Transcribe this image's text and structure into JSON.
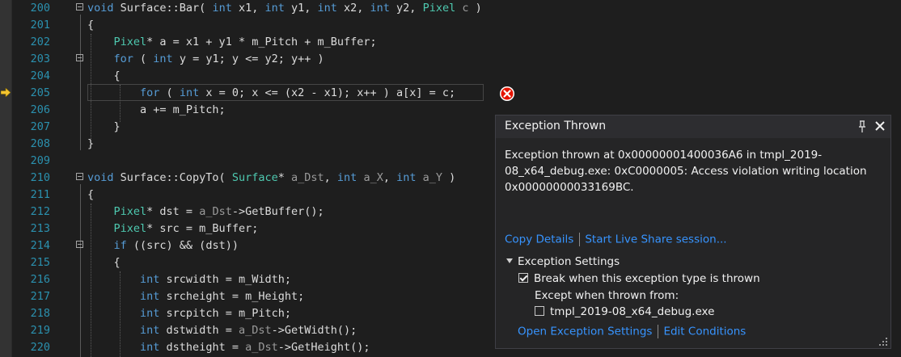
{
  "editor": {
    "lines": [
      {
        "num": "200",
        "tokens": [
          {
            "t": "void",
            "c": "kw"
          },
          {
            "t": " Surface::Bar( ",
            "c": ""
          },
          {
            "t": "int",
            "c": "kw"
          },
          {
            "t": " x1, ",
            "c": ""
          },
          {
            "t": "int",
            "c": "kw"
          },
          {
            "t": " y1, ",
            "c": ""
          },
          {
            "t": "int",
            "c": "kw"
          },
          {
            "t": " x2, ",
            "c": ""
          },
          {
            "t": "int",
            "c": "kw"
          },
          {
            "t": " y2, ",
            "c": ""
          },
          {
            "t": "Pixel",
            "c": "ty"
          },
          {
            "t": " ",
            "c": ""
          },
          {
            "t": "c",
            "c": "pm"
          },
          {
            "t": " )",
            "c": ""
          }
        ]
      },
      {
        "num": "201",
        "tokens": [
          {
            "t": "{",
            "c": ""
          }
        ]
      },
      {
        "num": "202",
        "tokens": [
          {
            "t": "    ",
            "c": ""
          },
          {
            "t": "Pixel",
            "c": "ty"
          },
          {
            "t": "* a = x1 + y1 * m_Pitch + m_Buffer;",
            "c": ""
          }
        ]
      },
      {
        "num": "203",
        "tokens": [
          {
            "t": "    ",
            "c": ""
          },
          {
            "t": "for",
            "c": "kw"
          },
          {
            "t": " ( ",
            "c": ""
          },
          {
            "t": "int",
            "c": "kw"
          },
          {
            "t": " y = y1; y <= y2; y++ )",
            "c": ""
          }
        ]
      },
      {
        "num": "204",
        "tokens": [
          {
            "t": "    {",
            "c": ""
          }
        ]
      },
      {
        "num": "205",
        "tokens": [
          {
            "t": "        ",
            "c": ""
          },
          {
            "t": "for",
            "c": "kw"
          },
          {
            "t": " ( ",
            "c": ""
          },
          {
            "t": "int",
            "c": "kw"
          },
          {
            "t": " x = 0; x <= (x2 - x1); x++ ) a[x] = c;",
            "c": ""
          }
        ]
      },
      {
        "num": "206",
        "tokens": [
          {
            "t": "        a += m_Pitch;",
            "c": ""
          }
        ]
      },
      {
        "num": "207",
        "tokens": [
          {
            "t": "    }",
            "c": ""
          }
        ]
      },
      {
        "num": "208",
        "tokens": [
          {
            "t": "}",
            "c": ""
          }
        ]
      },
      {
        "num": "209",
        "tokens": []
      },
      {
        "num": "210",
        "tokens": [
          {
            "t": "void",
            "c": "kw"
          },
          {
            "t": " Surface::CopyTo( ",
            "c": ""
          },
          {
            "t": "Surface",
            "c": "ty"
          },
          {
            "t": "* ",
            "c": ""
          },
          {
            "t": "a_Dst",
            "c": "pm"
          },
          {
            "t": ", ",
            "c": ""
          },
          {
            "t": "int",
            "c": "kw"
          },
          {
            "t": " ",
            "c": ""
          },
          {
            "t": "a_X",
            "c": "pm"
          },
          {
            "t": ", ",
            "c": ""
          },
          {
            "t": "int",
            "c": "kw"
          },
          {
            "t": " ",
            "c": ""
          },
          {
            "t": "a_Y",
            "c": "pm"
          },
          {
            "t": " )",
            "c": ""
          }
        ]
      },
      {
        "num": "211",
        "tokens": [
          {
            "t": "{",
            "c": ""
          }
        ]
      },
      {
        "num": "212",
        "tokens": [
          {
            "t": "    ",
            "c": ""
          },
          {
            "t": "Pixel",
            "c": "ty"
          },
          {
            "t": "* dst = ",
            "c": ""
          },
          {
            "t": "a_Dst",
            "c": "pm"
          },
          {
            "t": "->GetBuffer();",
            "c": ""
          }
        ]
      },
      {
        "num": "213",
        "tokens": [
          {
            "t": "    ",
            "c": ""
          },
          {
            "t": "Pixel",
            "c": "ty"
          },
          {
            "t": "* src = m_Buffer;",
            "c": ""
          }
        ]
      },
      {
        "num": "214",
        "tokens": [
          {
            "t": "    ",
            "c": ""
          },
          {
            "t": "if",
            "c": "kw"
          },
          {
            "t": " ((src) && (dst))",
            "c": ""
          }
        ]
      },
      {
        "num": "215",
        "tokens": [
          {
            "t": "    {",
            "c": ""
          }
        ]
      },
      {
        "num": "216",
        "tokens": [
          {
            "t": "        ",
            "c": ""
          },
          {
            "t": "int",
            "c": "kw"
          },
          {
            "t": " srcwidth = m_Width;",
            "c": ""
          }
        ]
      },
      {
        "num": "217",
        "tokens": [
          {
            "t": "        ",
            "c": ""
          },
          {
            "t": "int",
            "c": "kw"
          },
          {
            "t": " srcheight = m_Height;",
            "c": ""
          }
        ]
      },
      {
        "num": "218",
        "tokens": [
          {
            "t": "        ",
            "c": ""
          },
          {
            "t": "int",
            "c": "kw"
          },
          {
            "t": " srcpitch = m_Pitch;",
            "c": ""
          }
        ]
      },
      {
        "num": "219",
        "tokens": [
          {
            "t": "        ",
            "c": ""
          },
          {
            "t": "int",
            "c": "kw"
          },
          {
            "t": " dstwidth = ",
            "c": ""
          },
          {
            "t": "a_Dst",
            "c": "pm"
          },
          {
            "t": "->GetWidth();",
            "c": ""
          }
        ]
      },
      {
        "num": "220",
        "tokens": [
          {
            "t": "        ",
            "c": ""
          },
          {
            "t": "int",
            "c": "kw"
          },
          {
            "t": " dstheight = ",
            "c": ""
          },
          {
            "t": "a_Dst",
            "c": "pm"
          },
          {
            "t": "->GetHeight();",
            "c": ""
          }
        ]
      }
    ],
    "fold_lines": [
      "200",
      "203",
      "210",
      "214"
    ],
    "current_line": "205",
    "icons": {
      "exec": "current-statement-arrow-icon",
      "error": "exception-error-icon"
    },
    "colors": {
      "keyword": "#569cd6",
      "type": "#4ec9b0",
      "param": "#9a9a9a",
      "line_number": "#2b91af",
      "exec_arrow": "#f4c430",
      "error": "#e51400",
      "link": "#3794ff"
    }
  },
  "popup": {
    "title": "Exception Thrown",
    "message": "Exception thrown at 0x00000001400036A6 in tmpl_2019-08_x64_debug.exe: 0xC0000005: Access violation writing location 0x00000000033169BC.",
    "copy_details": "Copy Details",
    "live_share": "Start Live Share session...",
    "settings_header": "Exception Settings",
    "break_label": "Break when this exception type is thrown",
    "break_checked": true,
    "except_label": "Except when thrown from:",
    "exclusion_label": "tmpl_2019-08_x64_debug.exe",
    "exclusion_checked": false,
    "open_settings": "Open Exception Settings",
    "edit_conditions": "Edit Conditions",
    "icons": {
      "pin": "pin-icon",
      "close": "close-icon",
      "expand": "triangle-expanded-icon",
      "resize": "resize-grip-icon"
    }
  }
}
